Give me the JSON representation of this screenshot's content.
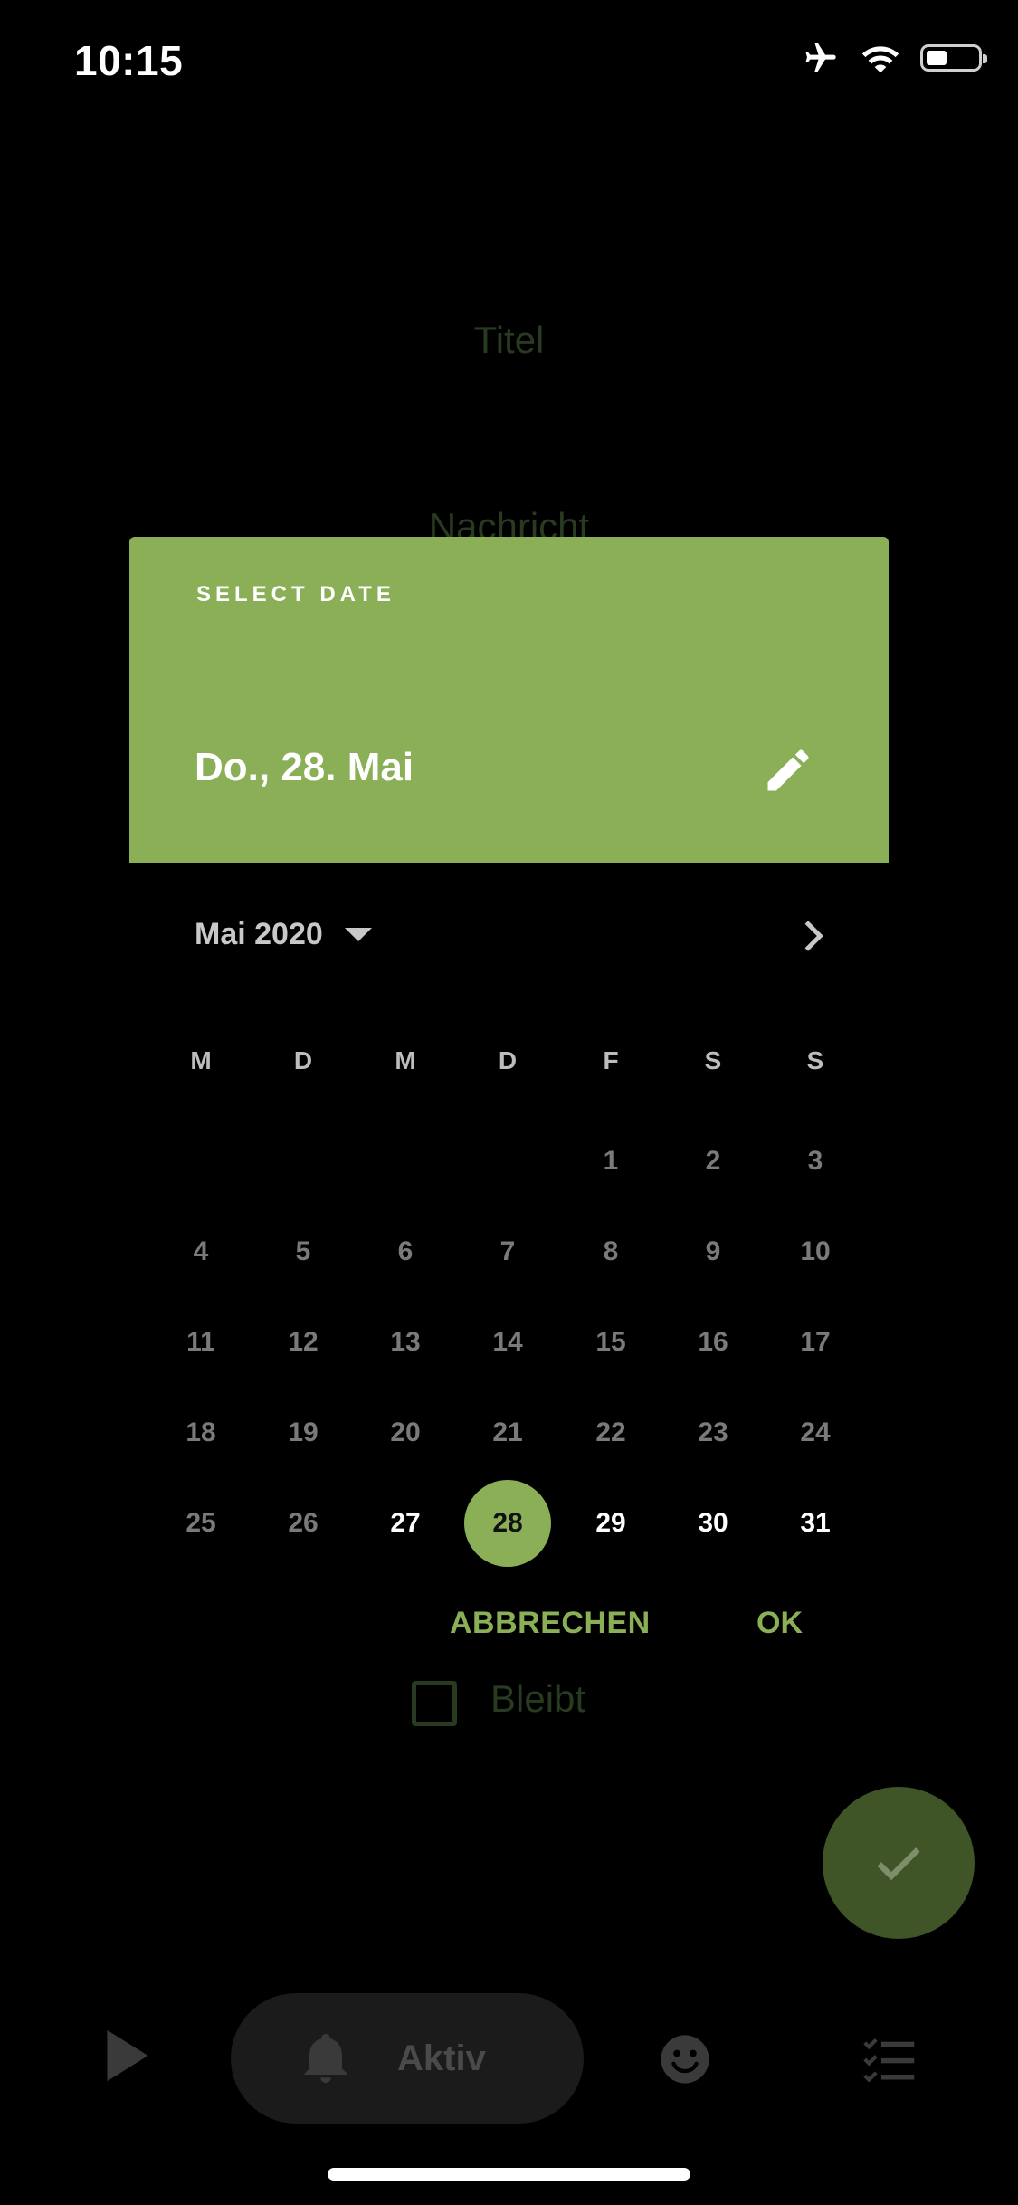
{
  "status_bar": {
    "time": "10:15"
  },
  "background_form": {
    "title_placeholder": "Titel",
    "message_placeholder": "Nachricht",
    "checkbox_label": "Bleibt"
  },
  "date_dialog": {
    "header_label": "SELECT DATE",
    "selected_date": "Do., 28. Mai",
    "month_year": "Mai 2020",
    "weekdays": [
      "M",
      "D",
      "M",
      "D",
      "F",
      "S",
      "S"
    ],
    "weeks": [
      [
        "",
        "",
        "",
        "",
        "1",
        "2",
        "3"
      ],
      [
        "4",
        "5",
        "6",
        "7",
        "8",
        "9",
        "10"
      ],
      [
        "11",
        "12",
        "13",
        "14",
        "15",
        "16",
        "17"
      ],
      [
        "18",
        "19",
        "20",
        "21",
        "22",
        "23",
        "24"
      ],
      [
        "25",
        "26",
        "27",
        "28",
        "29",
        "30",
        "31"
      ]
    ],
    "selected_day": "28",
    "first_selectable_day": 27,
    "cancel_label": "ABBRECHEN",
    "ok_label": "OK"
  },
  "bottom_nav": {
    "active_label": "Aktiv"
  },
  "colors": {
    "accent": "#8aaf56",
    "background": "#000000"
  }
}
